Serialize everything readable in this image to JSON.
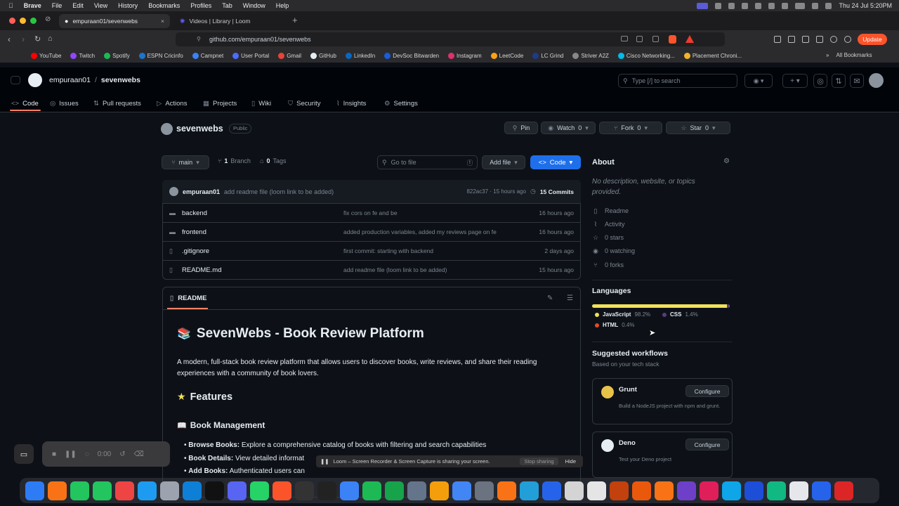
{
  "menubar": {
    "app": "Brave",
    "items": [
      "File",
      "Edit",
      "View",
      "History",
      "Bookmarks",
      "Profiles",
      "Tab",
      "Window",
      "Help"
    ],
    "clock": "Thu 24 Jul  5:20PM"
  },
  "tabs": [
    {
      "label": "empuraan01/sevenwebs"
    },
    {
      "label": "Videos | Library | Loom"
    }
  ],
  "address": {
    "url": "github.com/empuraan01/sevenwebs",
    "update_label": "Update"
  },
  "bookmarks": [
    {
      "label": "YouTube",
      "color": "#ff0000"
    },
    {
      "label": "Twitch",
      "color": "#9146ff"
    },
    {
      "label": "Spotify",
      "color": "#1db954"
    },
    {
      "label": "ESPN Cricinfo",
      "color": "#1e74c9"
    },
    {
      "label": "Campnet",
      "color": "#3b82f6"
    },
    {
      "label": "User Portal",
      "color": "#4d6bff"
    },
    {
      "label": "Gmail",
      "color": "#ea4335"
    },
    {
      "label": "GitHub",
      "color": "#e6edf3"
    },
    {
      "label": "LinkedIn",
      "color": "#0a66c2"
    },
    {
      "label": "DevSoc Bitwarden",
      "color": "#175ddc"
    },
    {
      "label": "Instagram",
      "color": "#e1306c"
    },
    {
      "label": "LeetCode",
      "color": "#ffa116"
    },
    {
      "label": "LC Grind",
      "color": "#1e3a8a"
    },
    {
      "label": "Striver A2Z",
      "color": "#888888"
    },
    {
      "label": "Cisco Networking...",
      "color": "#00bceb"
    },
    {
      "label": "Placement Chroni...",
      "color": "#f0b429"
    }
  ],
  "bookmarks_all": "All Bookmarks",
  "gh": {
    "owner": "empuraan01",
    "repo": "sevenwebs",
    "search": "Type [/] to search",
    "visibility": "Public"
  },
  "nav": [
    "Code",
    "Issues",
    "Pull requests",
    "Actions",
    "Projects",
    "Wiki",
    "Security",
    "Insights",
    "Settings"
  ],
  "repo_actions": {
    "pin": "Pin",
    "watch": "Watch",
    "watch_count": "0",
    "fork": "Fork",
    "fork_count": "0",
    "star": "Star",
    "star_count": "0"
  },
  "branch": {
    "name": "main",
    "branches": "1",
    "branches_label": "Branch",
    "tags": "0",
    "tags_label": "Tags",
    "goto": "Go to file",
    "goto_key": "t",
    "add_file": "Add file",
    "code": "Code"
  },
  "commit": {
    "author": "empuraan01",
    "message": "add readme file (loom link to be added)",
    "hash_time": "822ac37 · 15 hours ago",
    "count": "15 Commits"
  },
  "files": [
    {
      "name": "backend",
      "type": "dir",
      "msg": "fix cors on fe and be",
      "time": "16 hours ago"
    },
    {
      "name": "frontend",
      "type": "dir",
      "msg": "added production variables, added my reviews page on fe",
      "time": "16 hours ago"
    },
    {
      "name": ".gitignore",
      "type": "file",
      "msg": "first commit: starting with backend",
      "time": "2 days ago"
    },
    {
      "name": "README.md",
      "type": "file",
      "msg": "add readme file (loom link to be added)",
      "time": "15 hours ago"
    }
  ],
  "readme": {
    "tab": "README",
    "title": "SevenWebs - Book Review Platform",
    "intro": "A modern, full-stack book review platform that allows users to discover books, write reviews, and share their reading experiences with a community of book lovers.",
    "features": "Features",
    "sub": "Book Management",
    "bullets": [
      {
        "b": "Browse Books:",
        "t": " Explore a comprehensive catalog of books with filtering and search capabilities"
      },
      {
        "b": "Book Details:",
        "t": " View detailed informat"
      },
      {
        "b": "Add Books:",
        "t": " Authenticated users can"
      }
    ]
  },
  "about": {
    "title": "About",
    "desc": "No description, website, or topics provided.",
    "items": [
      "Readme",
      "Activity",
      "0 stars",
      "0 watching",
      "0 forks"
    ]
  },
  "languages": {
    "title": "Languages",
    "list": [
      {
        "name": "JavaScript",
        "pct": "98.2%",
        "value": 98.2,
        "color": "#f1e05a"
      },
      {
        "name": "CSS",
        "pct": "1.4%",
        "value": 1.4,
        "color": "#563d7c"
      },
      {
        "name": "HTML",
        "pct": "0.4%",
        "value": 0.4,
        "color": "#e34c26"
      }
    ]
  },
  "workflows": {
    "title": "Suggested workflows",
    "sub": "Based on your tech stack",
    "items": [
      {
        "name": "Grunt",
        "desc": "Build a NodeJS project with npm and grunt.",
        "btn": "Configure"
      },
      {
        "name": "Deno",
        "desc": "Test your Deno project",
        "btn": "Configure"
      }
    ]
  },
  "loom": {
    "time": "0:00",
    "share_msg": "Loom – Screen Recorder & Screen Capture is sharing your screen.",
    "stop": "Stop sharing",
    "hide": "Hide"
  },
  "dock_colors": [
    "#2d7cf6",
    "#f97316",
    "#22c55e",
    "#22c55e",
    "#ef4444",
    "#1d9bf0",
    "#9ca3af",
    "#0e7fd6",
    "#111111",
    "#5865f2",
    "#25d366",
    "#fb542b",
    "#333333",
    "#222222",
    "#3b82f6",
    "#1db954",
    "#16a34a",
    "#64748b",
    "#f59e0b",
    "#4285f4",
    "#6b7280",
    "#f97316",
    "#229ed9",
    "#2563eb",
    "#d4d4d4",
    "#e5e5e5",
    "#c2410c",
    "#ea580c",
    "#f97316",
    "#6e40c9",
    "#e01e5a",
    "#0ea5e9",
    "#1d4ed8",
    "#10b981",
    "#e5e7eb",
    "#2563eb",
    "#dc2626",
    "#3b82f6",
    "#2563eb",
    "#9ca3af"
  ]
}
